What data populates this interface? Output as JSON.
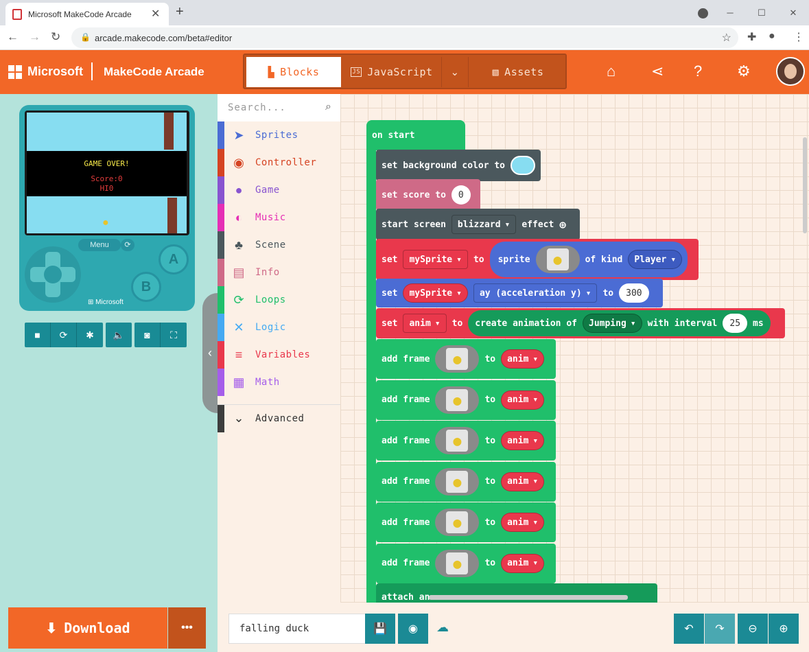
{
  "browser": {
    "tab_title": "Microsoft MakeCode Arcade",
    "url": "arcade.makecode.com/beta#editor",
    "win_min": "─",
    "win_max": "☐",
    "win_close": "✕",
    "tab_close": "✕",
    "new_tab": "+"
  },
  "header": {
    "brand": "Microsoft",
    "app": "MakeCode Arcade",
    "tabs": {
      "blocks": "Blocks",
      "javascript": "JavaScript",
      "assets": "Assets"
    }
  },
  "simulator": {
    "screen": {
      "title": "GAME OVER!",
      "score": "Score:0",
      "hi": "HI0"
    },
    "menu": "Menu",
    "a": "A",
    "b": "B",
    "brand": "Microsoft"
  },
  "download": {
    "label": "Download",
    "more": "•••"
  },
  "toolbox": {
    "search_placeholder": "Search...",
    "categories": [
      {
        "label": "Sprites",
        "color": "#4b6cd4"
      },
      {
        "label": "Controller",
        "color": "#d54322"
      },
      {
        "label": "Game",
        "color": "#8854d0"
      },
      {
        "label": "Music",
        "color": "#e52fb5"
      },
      {
        "label": "Scene",
        "color": "#4b585d"
      },
      {
        "label": "Info",
        "color": "#cf6a87"
      },
      {
        "label": "Loops",
        "color": "#20bf6b"
      },
      {
        "label": "Logic",
        "color": "#45aaf2"
      },
      {
        "label": "Variables",
        "color": "#e9384c"
      },
      {
        "label": "Math",
        "color": "#a55eea"
      }
    ],
    "advanced": "Advanced"
  },
  "blocks": {
    "on_start": "on start",
    "set_bg": {
      "label": "set background color to",
      "color": "#87ddf1"
    },
    "set_score": {
      "label": "set score to",
      "value": "0"
    },
    "start_screen": {
      "label": "start screen",
      "effect": "blizzard",
      "suffix": "effect"
    },
    "set_sprite": {
      "set": "set",
      "var": "mySprite",
      "to": "to",
      "sprite": "sprite",
      "of_kind": "of kind",
      "kind": "Player"
    },
    "set_ay": {
      "set": "set",
      "var": "mySprite",
      "prop": "ay (acceleration y)",
      "to": "to",
      "value": "300"
    },
    "set_anim": {
      "set": "set",
      "var": "anim",
      "to": "to",
      "create": "create animation of",
      "anim_name": "Jumping",
      "with_interval": "with interval",
      "interval": "25",
      "ms": "ms"
    },
    "add_frame": {
      "label": "add frame",
      "to": "to",
      "var": "anim",
      "count": 6
    },
    "attach": "attach an"
  },
  "bottom": {
    "project_name": "falling duck"
  }
}
